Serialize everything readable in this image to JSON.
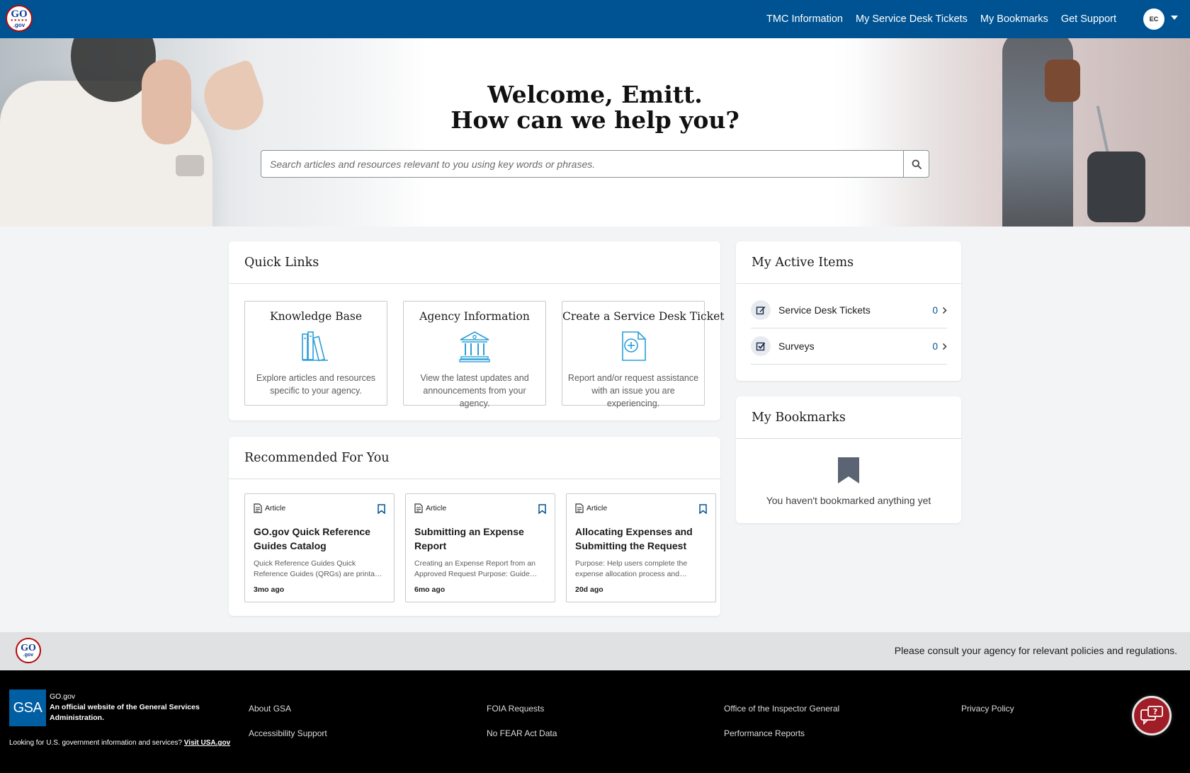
{
  "nav": {
    "logo_text": "GO.gov",
    "links": [
      "TMC Information",
      "My Service Desk Tickets",
      "My Bookmarks",
      "Get Support"
    ],
    "avatar_initials": "EC"
  },
  "hero": {
    "title_line1": "Welcome, Emitt.",
    "title_line2": "How can we help you?",
    "search_placeholder": "Search articles and resources relevant to you using key words or phrases."
  },
  "quick_links": {
    "title": "Quick Links",
    "tiles": [
      {
        "title": "Knowledge Base",
        "desc": "Explore articles and resources specific to your agency.",
        "icon": "books-icon"
      },
      {
        "title": "Agency Information",
        "desc": "View the latest updates and announcements from your agency.",
        "icon": "building-icon"
      },
      {
        "title": "Create a Service Desk Ticket",
        "desc": "Report and/or request assistance with an issue you are experiencing.",
        "icon": "new-document-icon"
      }
    ]
  },
  "recommended": {
    "title": "Recommended For You",
    "articles": [
      {
        "type": "Article",
        "title": "GO.gov Quick Reference Guides Catalog",
        "desc": "Quick Reference Guides Quick Reference Guides (QRGs) are printable step-by-step guides",
        "age": "3mo ago"
      },
      {
        "type": "Article",
        "title": "Submitting an Expense Report",
        "desc": "Creating an Expense Report from an Approved Request Purpose: Guide users through",
        "age": "6mo ago"
      },
      {
        "type": "Article",
        "title": "Allocating Expenses and Submitting the Request",
        "desc": "Purpose: Help users complete the expense allocation process and submitting",
        "age": "20d ago"
      }
    ]
  },
  "active_items": {
    "title": "My Active Items",
    "rows": [
      {
        "label": "Service Desk Tickets",
        "count": "0",
        "icon": "edit-icon"
      },
      {
        "label": "Surveys",
        "count": "0",
        "icon": "checkbox-icon"
      }
    ]
  },
  "bookmarks": {
    "title": "My Bookmarks",
    "empty_text": "You haven't bookmarked anything yet"
  },
  "footer_strip": {
    "logo_text": "GO.gov",
    "note": "Please consult your agency for relevant policies and regulations."
  },
  "footer": {
    "gsa_logo": "GSA",
    "site_name": "GO.gov",
    "official_line1": "An official website of the General Services",
    "official_line2": "Administration.",
    "usa_prompt": "Looking for U.S. government information and services?",
    "usa_link": "Visit USA.gov",
    "links": [
      "About GSA",
      "Accessibility Support",
      "FOIA Requests",
      "No FEAR Act Data",
      "Office of the Inspector General",
      "Performance Reports",
      "Privacy Policy"
    ]
  },
  "colors": {
    "nav_blue": "#005392",
    "icon_blue": "#2a9fd8",
    "chat_red": "#a01c26"
  }
}
